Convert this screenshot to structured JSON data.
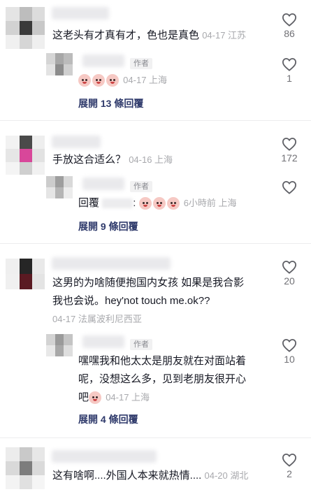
{
  "comments": [
    {
      "text": "这老头有才真有才，色也是真色",
      "meta": "04-17 江苏",
      "likes": "86",
      "reply": {
        "author_tag": "作者",
        "emoji_count": 3,
        "text": "",
        "meta": "04-17 上海",
        "likes": "1"
      },
      "expand": "展開 13 條回覆"
    },
    {
      "text": "手放这合适么？",
      "meta": "04-16 上海",
      "likes": "172",
      "reply": {
        "author_tag": "作者",
        "prefix": "回覆",
        "emoji_count": 3,
        "meta": "6小時前 上海"
      },
      "expand": "展開 9 條回覆"
    },
    {
      "text_line1": "这男的为啥随便抱国内女孩  如果是我合影",
      "text_line2": "我也会说。hey'not touch me.ok??",
      "meta": "04-17 法属波利尼西亚",
      "likes": "20",
      "reply": {
        "author_tag": "作者",
        "line1": "嘿嘿我和他太太是朋友就在对面站着",
        "line2": "呢，没想这么多，见到老朋友很开心",
        "line3": "吧",
        "meta": "04-17 上海",
        "likes": "10"
      },
      "expand": "展開 4 條回覆"
    },
    {
      "text": "这有啥啊....外国人本来就热情....",
      "meta": "04-20 湖北",
      "likes": "2"
    }
  ],
  "icons": {
    "like": "heart-outline-icon"
  },
  "colors": {
    "meta": "#a8a9ad",
    "expand": "#2f3a6b",
    "text": "#161823"
  }
}
